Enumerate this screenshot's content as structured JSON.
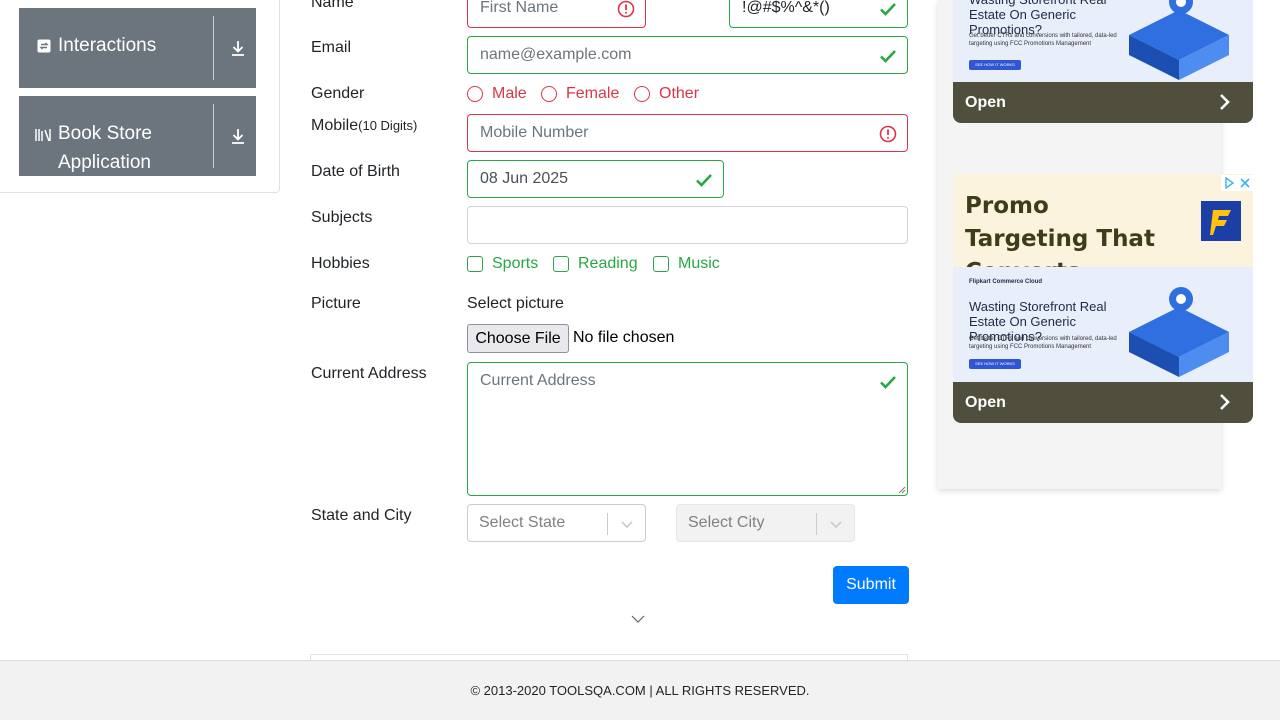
{
  "sidebar": {
    "items": [
      {
        "label": "Interactions",
        "icon": "interactions-icon"
      },
      {
        "label_line1": "Book Store",
        "label_line2": "Application",
        "icon": "book-store-icon"
      }
    ]
  },
  "form": {
    "name_label": "Name",
    "first_name_placeholder": "First Name",
    "last_name_value": "!@#$%^&*()",
    "email_label": "Email",
    "email_placeholder": "name@example.com",
    "gender_label": "Gender",
    "gender_options": [
      "Male",
      "Female",
      "Other"
    ],
    "mobile_label": "Mobile",
    "mobile_hint": "(10 Digits)",
    "mobile_placeholder": "Mobile Number",
    "dob_label": "Date of Birth",
    "dob_value": "08 Jun 2025",
    "subjects_label": "Subjects",
    "hobbies_label": "Hobbies",
    "hobbies_options": [
      "Sports",
      "Reading",
      "Music"
    ],
    "picture_label": "Picture",
    "picture_caption": "Select picture",
    "file_button": "Choose File",
    "file_status": "No file chosen",
    "address_label": "Current Address",
    "address_placeholder": "Current Address",
    "state_city_label": "State and City",
    "state_placeholder": "Select State",
    "city_placeholder": "Select City",
    "submit_label": "Submit"
  },
  "ads": {
    "card_headline": "Wasting Storefront Real Estate On Generic Promotions?",
    "card_sub": "Get better CTRs and conversions with tailored, data-led targeting using FCC Promotions Management",
    "card_cta": "SEE HOW IT WORKS",
    "card_brand": "Flipkart Commerce Cloud",
    "open_label": "Open",
    "promo_title": "Promo Targeting That Converts"
  },
  "colors": {
    "valid": "#28a745",
    "invalid": "#dc3545",
    "primary": "#007bff",
    "tile": "#6c757d"
  },
  "footer": {
    "text": "© 2013-2020 TOOLSQA.COM | ALL RIGHTS RESERVED."
  }
}
